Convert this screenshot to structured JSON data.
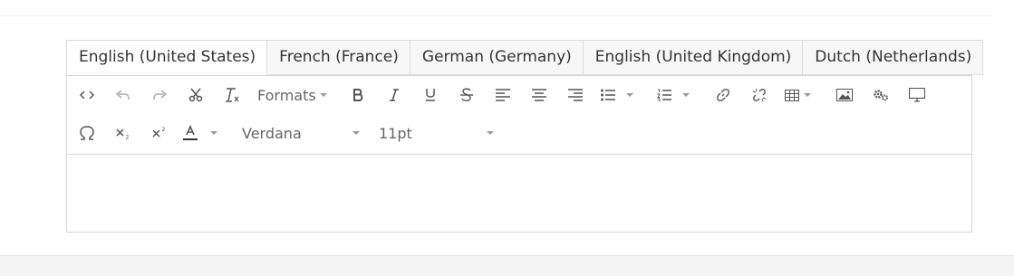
{
  "tabs": [
    {
      "label": "English (United States)",
      "active": true
    },
    {
      "label": "French (France)"
    },
    {
      "label": "German (Germany)"
    },
    {
      "label": "English (United Kingdom)"
    },
    {
      "label": "Dutch (Netherlands)"
    }
  ],
  "toolbar": {
    "formats_label": "Formats",
    "font_family": "Verdana",
    "font_size": "11pt",
    "icons": [
      "source-code-icon",
      "undo-icon",
      "redo-icon",
      "cut-icon",
      "clear-formatting-icon",
      "bold-icon",
      "italic-icon",
      "underline-icon",
      "strikethrough-icon",
      "align-left-icon",
      "align-center-icon",
      "align-right-icon",
      "bullet-list-icon",
      "numbered-list-icon",
      "link-icon",
      "unlink-icon",
      "table-icon",
      "image-icon",
      "settings-icon",
      "preview-icon",
      "special-character-icon",
      "subscript-icon",
      "superscript-icon",
      "text-color-icon"
    ]
  },
  "editor": {
    "content": ""
  }
}
